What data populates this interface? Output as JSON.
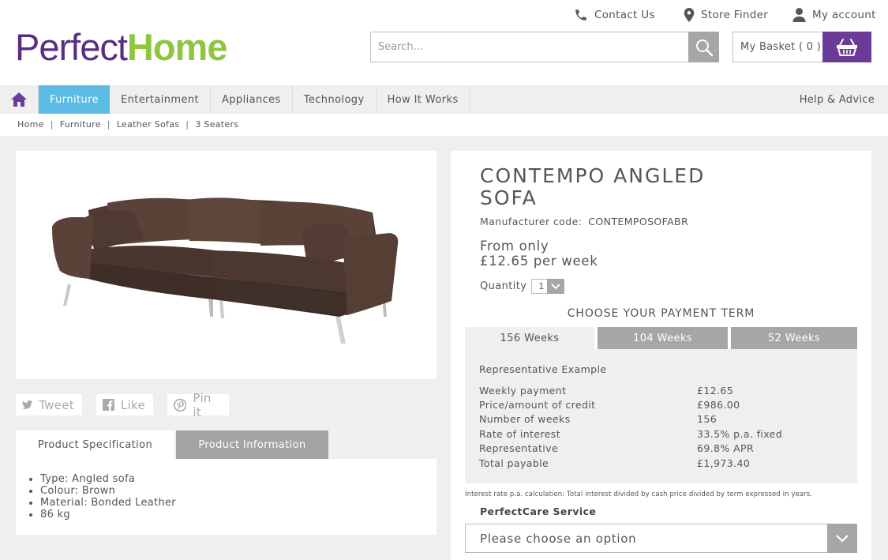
{
  "header": {
    "contact": "Contact Us",
    "store_finder": "Store Finder",
    "account": "My account",
    "logo_part1": "Perfect",
    "logo_part2": "Home",
    "search_placeholder": "Search...",
    "basket_label": "My Basket ( 0 )"
  },
  "nav": {
    "items": [
      "Furniture",
      "Entertainment",
      "Appliances",
      "Technology",
      "How It Works"
    ],
    "active": "Furniture",
    "help": "Help & Advice"
  },
  "breadcrumb": [
    "Home",
    "Furniture",
    "Leather Sofas",
    "3 Seaters"
  ],
  "social": {
    "tweet": "Tweet",
    "like": "Like",
    "pin": "Pin it"
  },
  "spec_tabs": {
    "spec": "Product Specification",
    "info": "Product Information"
  },
  "spec_items": [
    "Type: Angled sofa",
    "Colour: Brown",
    "Material: Bonded Leather",
    "86 kg"
  ],
  "product": {
    "title": "CONTEMPO ANGLED SOFA",
    "manufacturer_label": "Manufacturer code:",
    "manufacturer_code": "CONTEMPOSOFABR",
    "price_line1": "From only",
    "price_line2": "£12.65 per week",
    "quantity_label": "Quantity",
    "quantity_value": "1"
  },
  "payment": {
    "heading": "CHOOSE YOUR PAYMENT TERM",
    "terms": [
      "156 Weeks",
      "104 Weeks",
      "52 Weeks"
    ],
    "selected_term": "156 Weeks",
    "rep_title": "Representative Example",
    "rows": [
      {
        "label": "Weekly payment",
        "value": "£12.65"
      },
      {
        "label": "Price/amount of credit",
        "value": "£986.00"
      },
      {
        "label": "Number of weeks",
        "value": "156"
      },
      {
        "label": "Rate of interest",
        "value": "33.5% p.a. fixed"
      },
      {
        "label": "Representative",
        "value": "69.8% APR"
      },
      {
        "label": "Total payable",
        "value": "£1,973.40"
      }
    ],
    "footnote": "Interest rate p.a. calculation: Total interest divided by cash price divided by term expressed in years."
  },
  "perfectcare": {
    "label": "PerfectCare Service",
    "placeholder": "Please choose an option"
  },
  "colors": {
    "brand_purple": "#5a2d82",
    "brand_green": "#8dc63f",
    "nav_active": "#5bbde4",
    "basket_purple": "#6b3c97"
  }
}
